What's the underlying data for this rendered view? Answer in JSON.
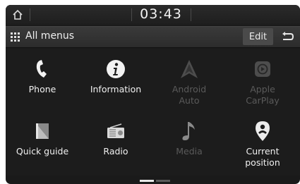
{
  "status": {
    "time": "03:43",
    "home_icon": "home-icon"
  },
  "menubar": {
    "title": "All menus",
    "edit_label": "Edit",
    "back_icon": "back-arrow-icon"
  },
  "tiles": [
    {
      "label": "Phone",
      "icon": "phone-icon",
      "enabled": true
    },
    {
      "label": "Information",
      "icon": "info-icon",
      "enabled": true
    },
    {
      "label": "Android\nAuto",
      "icon": "android-auto-icon",
      "enabled": false
    },
    {
      "label": "Apple\nCarPlay",
      "icon": "carplay-icon",
      "enabled": false
    },
    {
      "label": "Quick guide",
      "icon": "book-icon",
      "enabled": true
    },
    {
      "label": "Radio",
      "icon": "radio-icon",
      "enabled": true
    },
    {
      "label": "Media",
      "icon": "music-note-icon",
      "enabled": false
    },
    {
      "label": "Current\nposition",
      "icon": "location-pin-icon",
      "enabled": true
    }
  ],
  "pager": {
    "pages": 2,
    "current": 1
  },
  "colors": {
    "active": "#f0f0f0",
    "disabled": "#5a5a5a",
    "background": "#1c1c1c"
  }
}
